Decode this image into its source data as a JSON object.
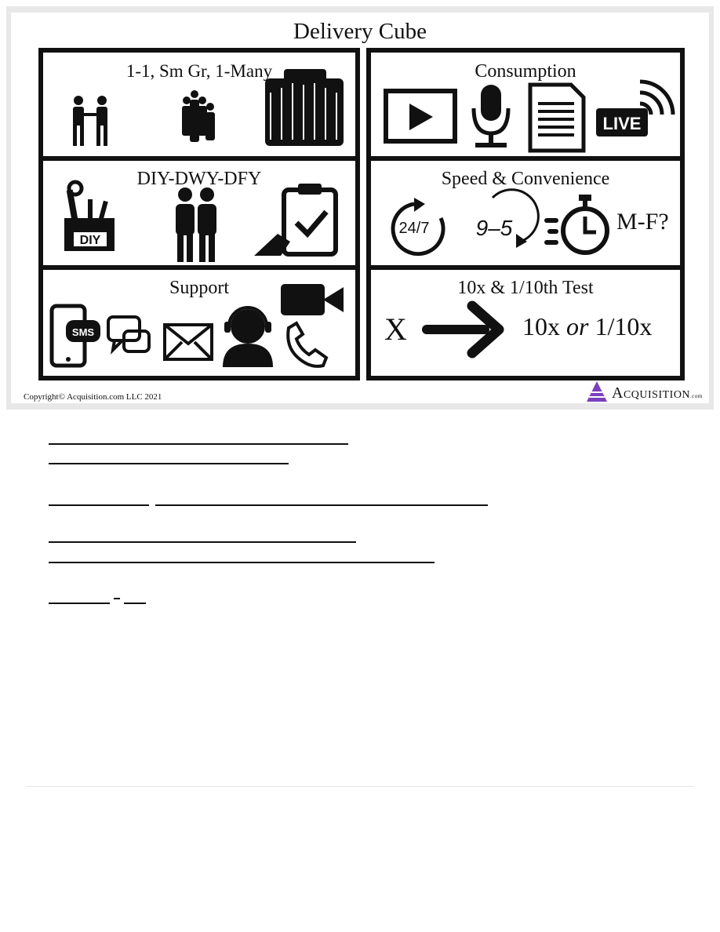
{
  "figure": {
    "title": "Delivery Cube",
    "copyright": "Copyright© Acquisition.com LLC 2021",
    "brand_name": "Acquisition",
    "brand_suffix": ".com",
    "cells": [
      {
        "title": "1-1, Sm Gr, 1-Many",
        "icons": [
          "one-to-one-icon",
          "small-group-icon",
          "crowd-icon"
        ]
      },
      {
        "title": "Consumption",
        "icons": [
          "video-play-icon",
          "microphone-icon",
          "document-icon",
          "live-broadcast-icon"
        ]
      },
      {
        "title": "DIY-DWY-DFY",
        "icons": [
          "diy-toolbox-icon",
          "two-people-icon",
          "checklist-clipboard-icon"
        ]
      },
      {
        "title": "Speed & Convenience",
        "icons": [
          "24-7-icon",
          "9-5-icon",
          "stopwatch-icon"
        ],
        "tag": "M-F?"
      },
      {
        "title": "Support",
        "icons": [
          "sms-phone-icon",
          "chat-bubbles-icon",
          "envelope-icon",
          "headset-agent-icon",
          "video-camera-icon",
          "phone-icon"
        ]
      },
      {
        "title": "10x & 1/10th Test",
        "left_text": "X",
        "right_text": "10x",
        "or_text": "or",
        "right_text2": "1/10x",
        "icons": [
          "arrow-right-icon"
        ]
      }
    ],
    "icon_labels": {
      "sms": "SMS",
      "live": "LIVE",
      "diy": "DIY",
      "h24": "24/7",
      "h95": "9–5"
    }
  }
}
